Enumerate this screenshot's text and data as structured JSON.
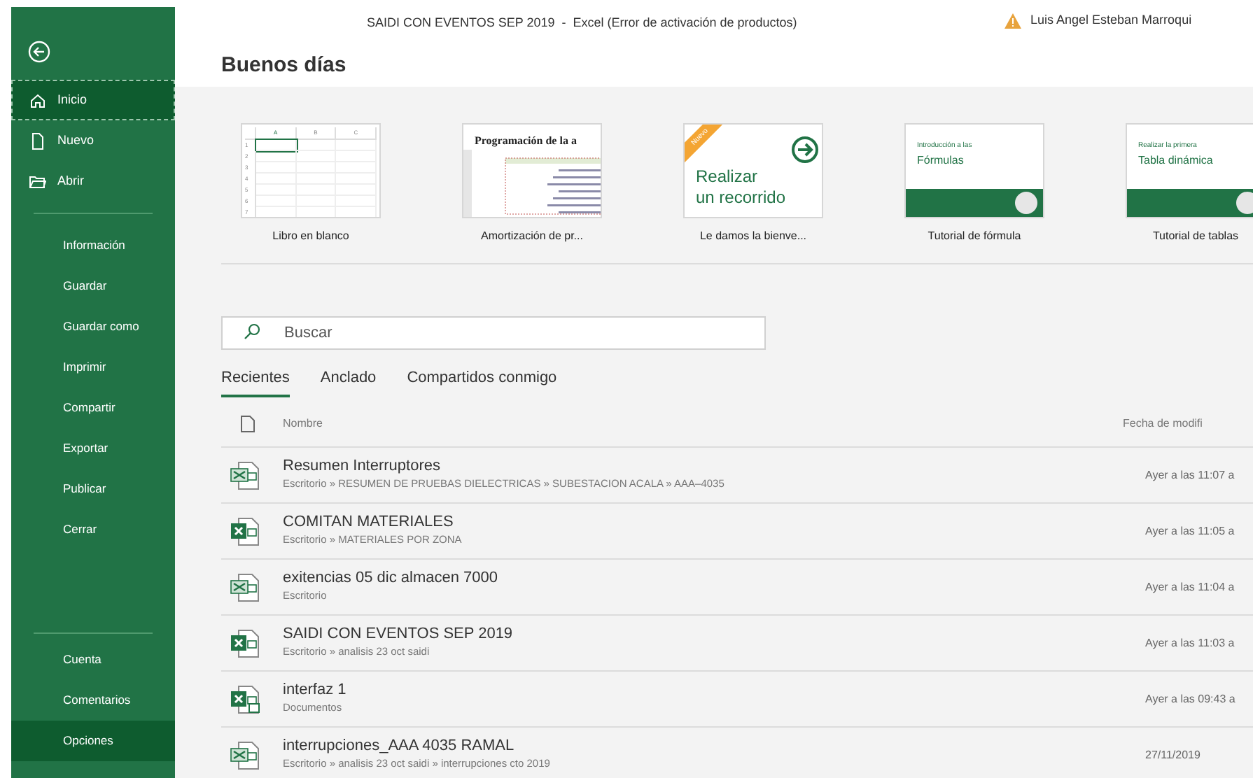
{
  "window": {
    "title": "SAIDI CON EVENTOS SEP 2019  -  Excel (Error de activación de productos)",
    "user": "Luis Angel Esteban Marroqui"
  },
  "sidebar": {
    "primary": [
      {
        "label": "Inicio",
        "kind": "home",
        "selected": true
      },
      {
        "label": "Nuevo",
        "kind": "new",
        "selected": false
      },
      {
        "label": "Abrir",
        "kind": "open",
        "selected": false
      }
    ],
    "secondary": [
      {
        "label": "Información",
        "hovered": false
      },
      {
        "label": "Guardar",
        "hovered": false
      },
      {
        "label": "Guardar como",
        "hovered": false
      },
      {
        "label": "Imprimir",
        "hovered": false
      },
      {
        "label": "Compartir",
        "hovered": false
      },
      {
        "label": "Exportar",
        "hovered": false
      },
      {
        "label": "Publicar",
        "hovered": false
      },
      {
        "label": "Cerrar",
        "hovered": false
      }
    ],
    "footer": [
      {
        "label": "Cuenta",
        "hovered": false
      },
      {
        "label": "Comentarios",
        "hovered": false
      },
      {
        "label": "Opciones",
        "hovered": true
      }
    ]
  },
  "greeting": "Buenos días",
  "templates": [
    {
      "kind": "blank",
      "label": "Libro en blanco",
      "columns": [
        "A",
        "B",
        "C"
      ],
      "rows": [
        "1",
        "2",
        "3",
        "4",
        "5",
        "6",
        "7"
      ]
    },
    {
      "kind": "amortization",
      "label": "Amortización de pr...",
      "heading": "Programación de la a"
    },
    {
      "kind": "tour",
      "label": "Le damos la bienve...",
      "badge": "Nuevo",
      "line1": "Realizar",
      "line2": "un recorrido"
    },
    {
      "kind": "formula",
      "label": "Tutorial de fórmula",
      "small": "Introducción a las",
      "big": "Fórmulas"
    },
    {
      "kind": "pivot",
      "label": "Tutorial de tablas",
      "small": "Realizar la primera",
      "big": "Tabla dinámica"
    }
  ],
  "search": {
    "placeholder": "Buscar"
  },
  "tabs": [
    {
      "label": "Recientes",
      "selected": true
    },
    {
      "label": "Anclado",
      "selected": false
    },
    {
      "label": "Compartidos conmigo",
      "selected": false
    }
  ],
  "table": {
    "columns": [
      "Nombre",
      "Fecha de modifi"
    ],
    "rows": [
      {
        "kind": "csv",
        "name": "Resumen Interruptores",
        "path": "Escritorio » RESUMEN DE PRUEBAS DIELECTRICAS » SUBESTACION ACALA » AAA–4035",
        "date": "Ayer a las 11:07 a"
      },
      {
        "kind": "xlsx",
        "name": "COMITAN MATERIALES",
        "path": "Escritorio » MATERIALES POR ZONA",
        "date": "Ayer a las 11:05 a"
      },
      {
        "kind": "csv",
        "name": "exitencias 05 dic almacen 7000",
        "path": "Escritorio",
        "date": "Ayer a las 11:04 a"
      },
      {
        "kind": "xlsx",
        "name": "SAIDI CON EVENTOS SEP 2019",
        "path": "Escritorio » analisis 23 oct saidi",
        "date": "Ayer a las 11:03 a"
      },
      {
        "kind": "xlsm",
        "name": "interfaz 1",
        "path": "Documentos",
        "date": "Ayer a las 09:43 a"
      },
      {
        "kind": "csv",
        "name": "interrupciones_AAA 4035 RAMAL",
        "path": "Escritorio » analisis 23 oct saidi » interrupciones cto 2019",
        "date": "27/11/2019"
      }
    ]
  }
}
